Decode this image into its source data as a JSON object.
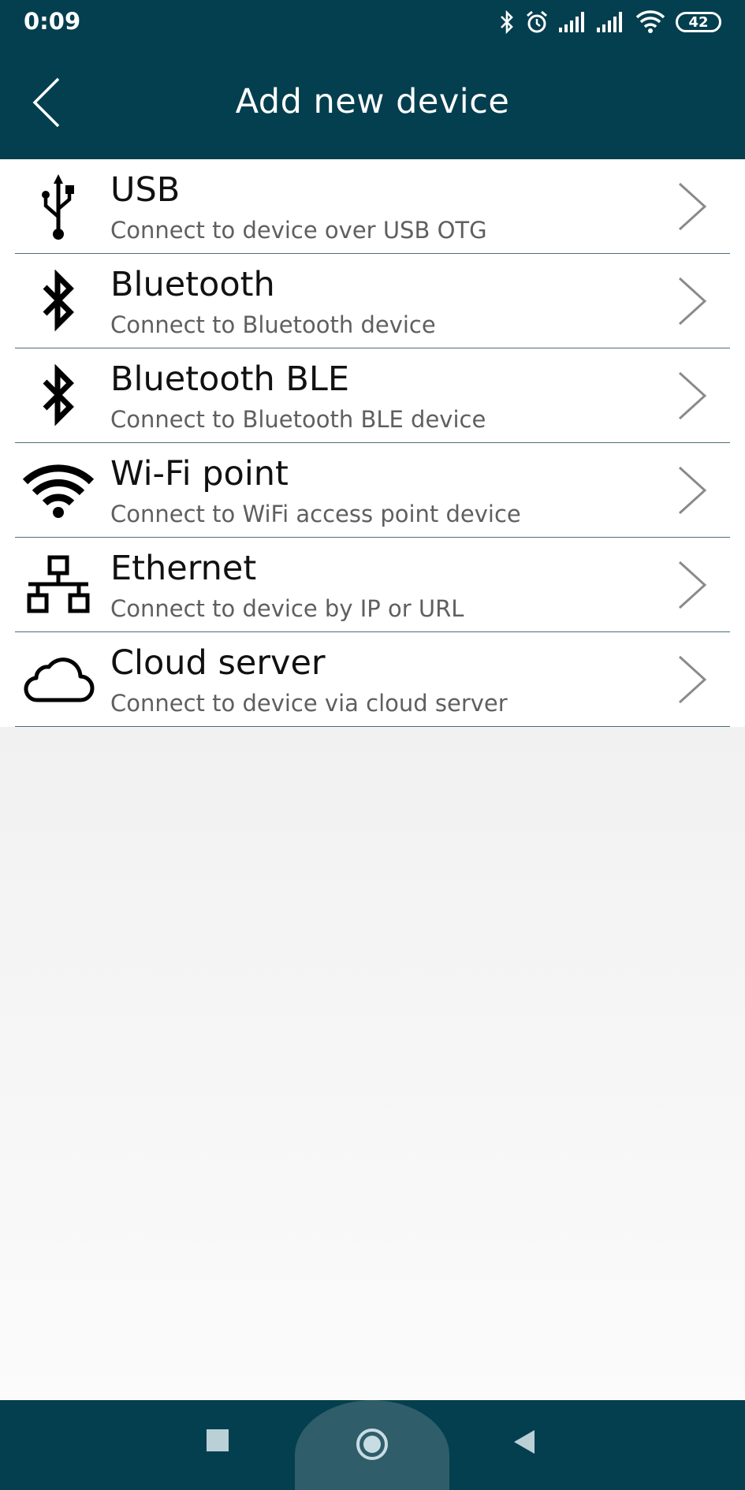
{
  "status": {
    "time": "0:09",
    "battery": "42",
    "icons": [
      "bluetooth-icon",
      "alarm-icon",
      "signal-icon",
      "signal-icon",
      "wifi-icon",
      "battery-icon"
    ]
  },
  "header": {
    "title": "Add new device",
    "back_icon": "chevron-left-icon"
  },
  "items": [
    {
      "title": "USB",
      "subtitle": "Connect to device over USB OTG",
      "icon": "usb-icon"
    },
    {
      "title": "Bluetooth",
      "subtitle": "Connect to Bluetooth device",
      "icon": "bluetooth-icon"
    },
    {
      "title": "Bluetooth BLE",
      "subtitle": "Connect to Bluetooth BLE device",
      "icon": "bluetooth-icon"
    },
    {
      "title": "Wi-Fi point",
      "subtitle": "Connect to WiFi access point device",
      "icon": "wifi-icon"
    },
    {
      "title": "Ethernet",
      "subtitle": "Connect to device by IP or URL",
      "icon": "ethernet-icon"
    },
    {
      "title": "Cloud server",
      "subtitle": "Connect to device via cloud server",
      "icon": "cloud-icon"
    }
  ],
  "nav": {
    "recents_icon": "square-icon",
    "home_icon": "circle-icon",
    "back_icon": "triangle-back-icon"
  },
  "colors": {
    "bar": "#043f4f",
    "separator": "#4e6c78",
    "chevron": "#8a8a8a"
  }
}
